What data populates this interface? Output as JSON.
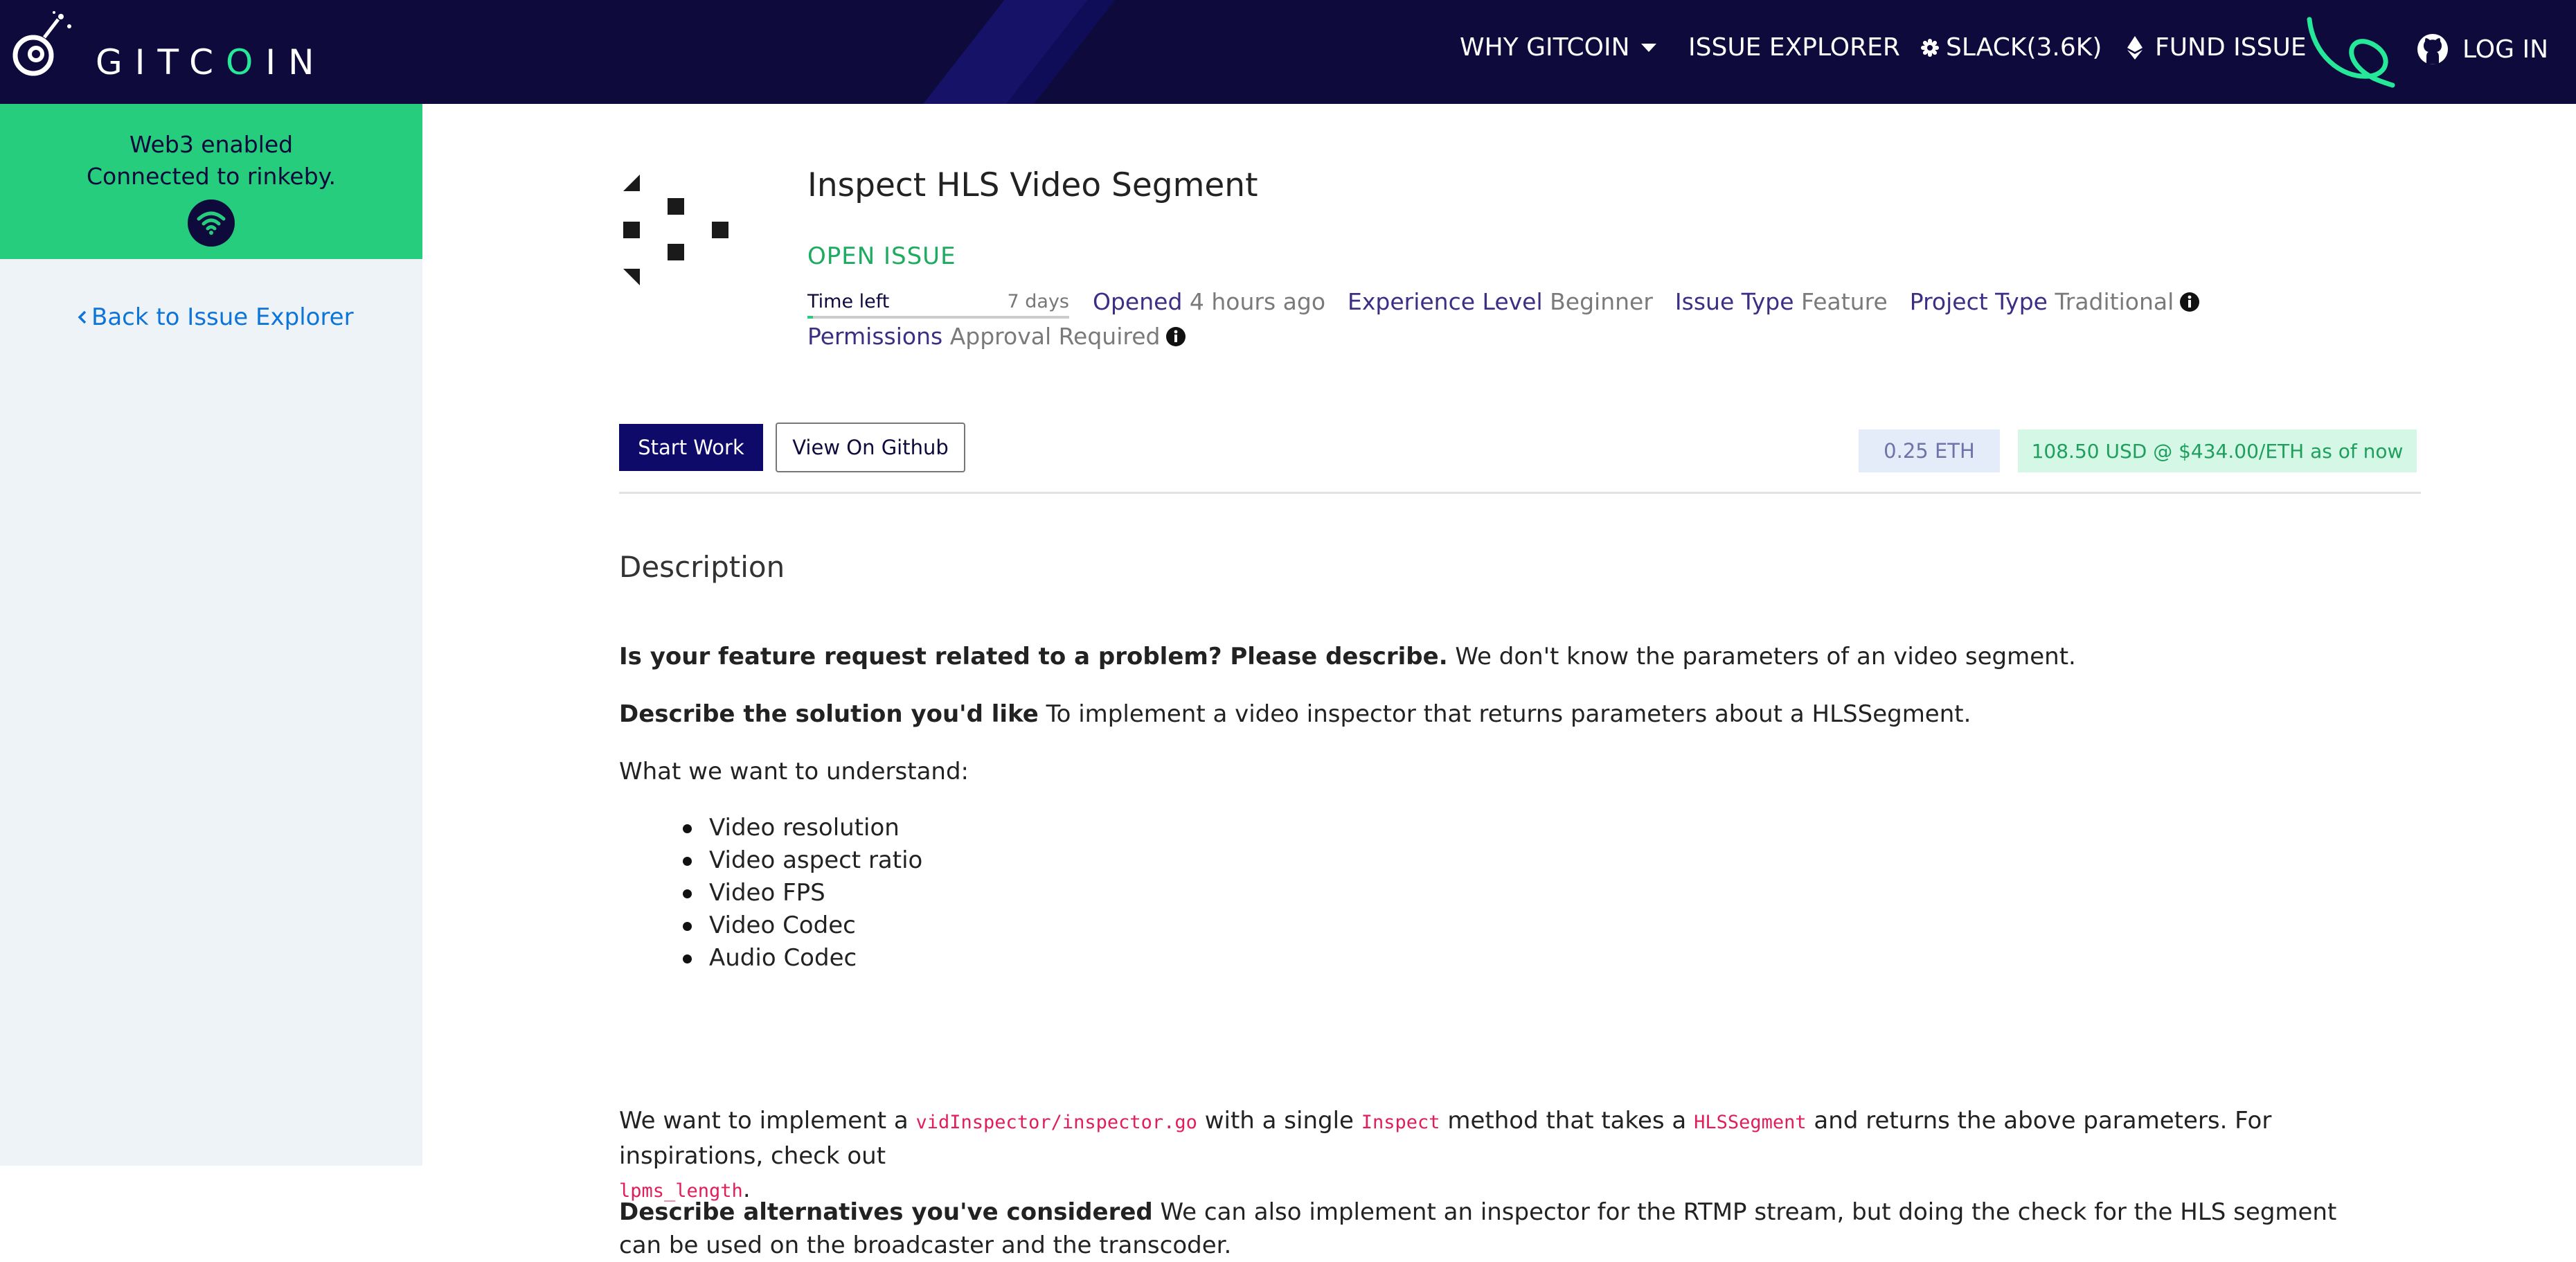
{
  "brand": {
    "name_pre": "GITC",
    "name_o": "O",
    "name_post": "IN"
  },
  "nav": {
    "why": "WHY GITCOIN",
    "explorer": "ISSUE EXPLORER",
    "slack": "SLACK(3.6K)",
    "fund": "FUND ISSUE",
    "login": "LOG IN"
  },
  "sidebar": {
    "web3_line1": "Web3 enabled",
    "web3_line2": "Connected to rinkeby.",
    "back_link": "Back to Issue Explorer"
  },
  "issue": {
    "title": "Inspect HLS Video Segment",
    "status": "OPEN ISSUE",
    "time_left_label": "Time left",
    "time_left_value": "7 days",
    "time_left_fraction": 0.02,
    "opened_key": "Opened",
    "opened_val": "4 hours ago",
    "experience_key": "Experience Level",
    "experience_val": "Beginner",
    "issue_type_key": "Issue Type",
    "issue_type_val": "Feature",
    "project_type_key": "Project Type",
    "project_type_val": "Traditional",
    "permissions_key": "Permissions",
    "permissions_val": "Approval Required"
  },
  "actions": {
    "start_work": "Start Work",
    "view_github": "View On Github"
  },
  "amount": {
    "eth": "0.25 ETH",
    "usd": "108.50  USD @ $434.00/ETH  as of now"
  },
  "description": {
    "heading": "Description",
    "p1_bold": "Is your feature request related to a problem? Please describe.",
    "p1_text": " We don't know the parameters of an video segment.",
    "p2_bold": "Describe the solution you'd like",
    "p2_text": " To implement a video inspector that returns parameters about a HLSSegment.",
    "p3": "What we want to understand:",
    "list": [
      "Video resolution",
      "Video aspect ratio",
      "Video FPS",
      "Video Codec",
      "Audio Codec"
    ],
    "p4_a": "We want to implement a ",
    "p4_code1": "vidInspector/inspector.go",
    "p4_b": " with a single ",
    "p4_code2": "Inspect",
    "p4_c": " method that takes a ",
    "p4_code3": "HLSSegment",
    "p4_d": " and returns the above parameters. For inspirations, check out",
    "p4_code4": "lpms_length",
    "p4_e": ".",
    "p5_bold": "Describe alternatives you've considered",
    "p5_text": " We can also implement an inspector for the RTMP stream, but doing the check for the HLS segment can be used on the broadcaster and the transcoder."
  },
  "colors": {
    "navbar": "#0e0a3c",
    "accent_green": "#25cd7c",
    "link_blue": "#0d74d9",
    "code_pink": "#e01e5a"
  }
}
